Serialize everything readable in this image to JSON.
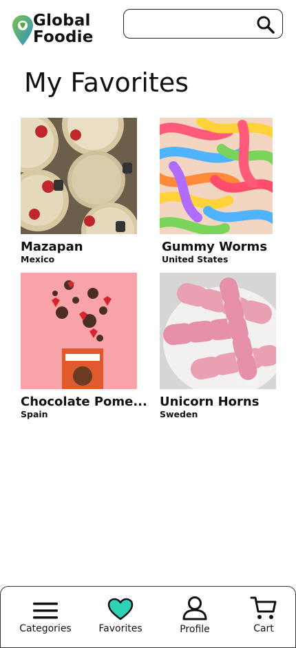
{
  "app": {
    "logo_line1": "Global",
    "logo_line2": "Foodie"
  },
  "search": {
    "value": "",
    "placeholder": ""
  },
  "page": {
    "title": "My Favorites"
  },
  "favorites": [
    {
      "name": "Mazapan",
      "country": "Mexico"
    },
    {
      "name": "Gummy Worms",
      "country": "United States"
    },
    {
      "name": "Chocolate Pome...",
      "country": "Spain"
    },
    {
      "name": "Unicorn Horns",
      "country": "Sweden"
    }
  ],
  "nav": {
    "categories": "Categories",
    "favorites": "Favorites",
    "profile": "Profile",
    "cart": "Cart"
  },
  "colors": {
    "accent": "#2ed3b7",
    "pin_green": "#6bbf4e",
    "pin_blue": "#2f8fc7"
  },
  "icons": [
    "location-pin-icon",
    "search-icon",
    "menu-icon",
    "heart-icon",
    "user-icon",
    "cart-icon"
  ]
}
